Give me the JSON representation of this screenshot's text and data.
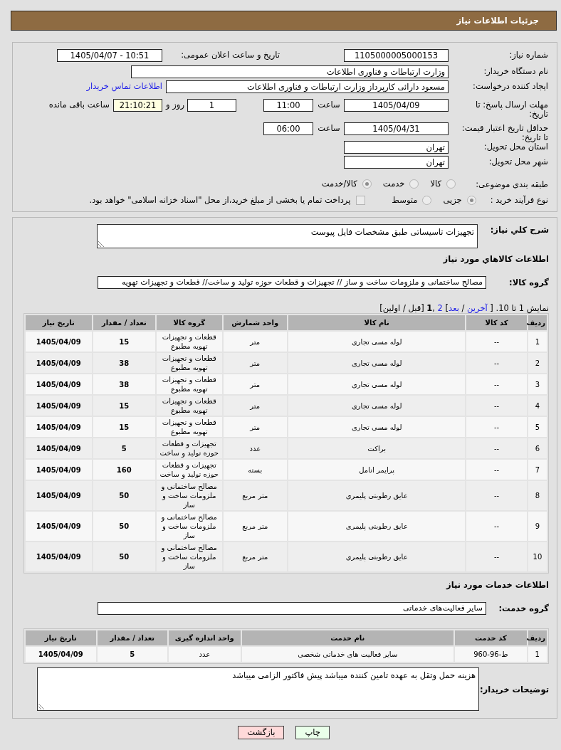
{
  "header": {
    "title": "جزئیات اطلاعات نیاز"
  },
  "details": {
    "need_number": {
      "label": "شماره نیاز:",
      "value": "1105000005000153"
    },
    "announce_datetime": {
      "label": "تاریخ و ساعت اعلان عمومی:",
      "value": "1405/04/07 - 10:51"
    },
    "buyer_org": {
      "label": "نام دستگاه خریدار:",
      "value": "وزارت ارتباطات و فناوری اطلاعات"
    },
    "requester": {
      "label": "ایجاد کننده درخواست:",
      "value": "مسعود دارائی کارپرداز وزارت ارتباطات و فناوری اطلاعات",
      "contact_link": "اطلاعات تماس خریدار"
    },
    "reply_deadline": {
      "label": "مهلت ارسال پاسخ: تا تاریخ:",
      "date": "1405/04/09",
      "time_label": "ساعت",
      "time": "11:00",
      "days": "1",
      "days_label": "روز و",
      "remaining": "21:10:21",
      "remaining_label": "ساعت باقی مانده"
    },
    "price_validity": {
      "label": "حداقل تاریخ اعتبار قیمت: تا تاریخ:",
      "date": "1405/04/31",
      "time_label": "ساعت",
      "time": "06:00"
    },
    "delivery_province": {
      "label": "استان محل تحویل:",
      "value": "تهران"
    },
    "delivery_city": {
      "label": "شهر محل تحویل:",
      "value": "تهران"
    },
    "subject_category": {
      "label": "طبقه بندی موضوعی:",
      "options": [
        {
          "label": "کالا",
          "selected": false
        },
        {
          "label": "خدمت",
          "selected": false
        },
        {
          "label": "کالا/خدمت",
          "selected": true
        }
      ]
    },
    "purchase_process": {
      "label": "نوع فرآیند خرید :",
      "options": [
        {
          "label": "جزیی",
          "selected": true
        },
        {
          "label": "متوسط",
          "selected": false
        }
      ],
      "treasury_payment": {
        "label": "پرداخت تمام یا بخشی از مبلغ خرید،از محل \"اسناد خزانه اسلامی\" خواهد بود.",
        "checked": false
      }
    }
  },
  "overview": {
    "label": "شرح کلي نیاز:",
    "value": "تجهیزات تاسیساتی طبق مشخصات فایل پیوست"
  },
  "goods": {
    "heading": "اطلاعات کالاهاي مورد نیاز",
    "group_label": "گروه کالا:",
    "group_value": "مصالح ساختمانی و ملزومات ساخت و ساز // تجهیزات و قطعات حوزه تولید و ساخت// قطعات و تجهیزات تهویه",
    "pagination": [
      {
        "kind": "text",
        "text": "نمایش 1 تا 10. [ "
      },
      {
        "kind": "link",
        "text": "آخرین"
      },
      {
        "kind": "text",
        "text": " / "
      },
      {
        "kind": "link",
        "text": "بعد"
      },
      {
        "kind": "text",
        "text": "] "
      },
      {
        "kind": "link",
        "text": "2"
      },
      {
        "kind": "text",
        "text": " ,"
      },
      {
        "kind": "current",
        "text": "1"
      },
      {
        "kind": "text",
        "text": " [قبل / اولین]"
      }
    ],
    "columns": [
      "ردیف",
      "کد کالا",
      "نام کالا",
      "واحد شمارش",
      "گروه کالا",
      "تعداد / مقدار",
      "تاریخ نیاز"
    ],
    "rows": [
      {
        "index": "1",
        "code": "--",
        "name": "لوله مسی تجاری",
        "unit": "متر",
        "group": "قطعات و تجهیزات تهویه مطبوع",
        "quantity": "15",
        "date": "1405/04/09"
      },
      {
        "index": "2",
        "code": "--",
        "name": "لوله مسی تجاری",
        "unit": "متر",
        "group": "قطعات و تجهیزات تهویه مطبوع",
        "quantity": "38",
        "date": "1405/04/09"
      },
      {
        "index": "3",
        "code": "--",
        "name": "لوله مسی تجاری",
        "unit": "متر",
        "group": "قطعات و تجهیزات تهویه مطبوع",
        "quantity": "38",
        "date": "1405/04/09"
      },
      {
        "index": "4",
        "code": "--",
        "name": "لوله مسی تجاری",
        "unit": "متر",
        "group": "قطعات و تجهیزات تهویه مطبوع",
        "quantity": "15",
        "date": "1405/04/09"
      },
      {
        "index": "5",
        "code": "--",
        "name": "لوله مسی تجاری",
        "unit": "متر",
        "group": "قطعات و تجهیزات تهویه مطبوع",
        "quantity": "15",
        "date": "1405/04/09"
      },
      {
        "index": "6",
        "code": "--",
        "name": "براکت",
        "unit": "عدد",
        "group": "تجهیزات و قطعات حوزه تولید و ساخت",
        "quantity": "5",
        "date": "1405/04/09"
      },
      {
        "index": "7",
        "code": "--",
        "name": "پرایمر انامل",
        "unit": "بسته",
        "group": "تجهیزات و قطعات حوزه تولید و ساخت",
        "quantity": "160",
        "date": "1405/04/09"
      },
      {
        "index": "8",
        "code": "--",
        "name": "عایق رطوبتی پلیمری",
        "unit": "متر مربع",
        "group": "مصالح ساختمانی و ملزومات ساخت و ساز",
        "quantity": "50",
        "date": "1405/04/09"
      },
      {
        "index": "9",
        "code": "--",
        "name": "عایق رطوبتی پلیمری",
        "unit": "متر مربع",
        "group": "مصالح ساختمانی و ملزومات ساخت و ساز",
        "quantity": "50",
        "date": "1405/04/09"
      },
      {
        "index": "10",
        "code": "--",
        "name": "عایق رطوبتی پلیمری",
        "unit": "متر مربع",
        "group": "مصالح ساختمانی و ملزومات ساخت و ساز",
        "quantity": "50",
        "date": "1405/04/09"
      }
    ]
  },
  "services": {
    "heading": "اطلاعات خدمات مورد نیاز",
    "group_label": "گروه خدمت:",
    "group_value": "سایر فعالیت‌های خدماتی",
    "columns": [
      "ردیف",
      "کد خدمت",
      "نام خدمت",
      "واحد اندازه گیری",
      "تعداد / مقدار",
      "تاریخ نیاز"
    ],
    "rows": [
      {
        "index": "1",
        "code": "ط-96-960",
        "name": "سایر فعالیت های خدماتی شخصی",
        "unit": "عدد",
        "quantity": "5",
        "date": "1405/04/09"
      }
    ]
  },
  "buyer_notes": {
    "label": "توضیحات خریدار:",
    "value": "هزینه حمل وتقل به عهده تامین کننده میباشد پیش فاکتور الزامی میباشد"
  },
  "buttons": [
    {
      "label": "چاپ",
      "kind": "print"
    },
    {
      "label": "بازگشت",
      "kind": "back"
    }
  ]
}
